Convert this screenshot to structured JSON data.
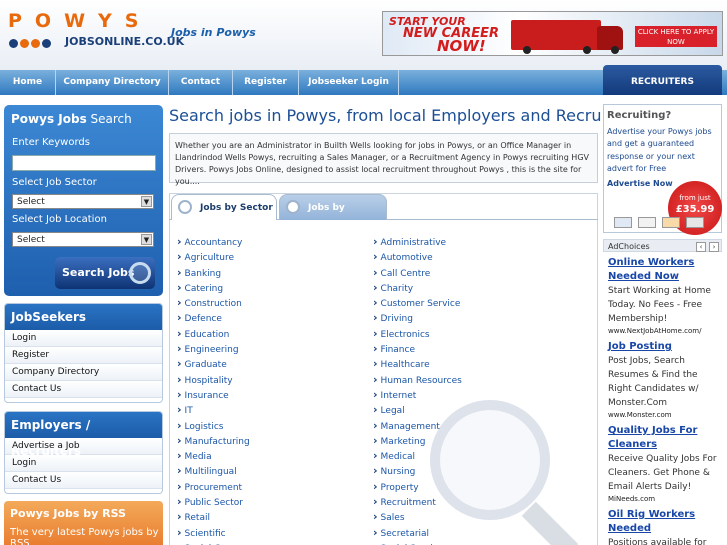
{
  "logo": {
    "letters": "POWYS",
    "subtitle": "JOBSONLINE.CO.UK",
    "dot_colors": [
      "#1b3f78",
      "#e86a0c",
      "#e86a0c",
      "#1b3f78"
    ]
  },
  "tagline": "Jobs in Powys",
  "banner": {
    "line1": "START YOUR",
    "line2": "NEW CAREER",
    "line3": "NOW!",
    "cta": "CLICK HERE TO APPLY NOW"
  },
  "nav": {
    "items": [
      "Home",
      "Company Directory",
      "Contact",
      "Register",
      "Jobseeker Login"
    ],
    "recruiters": "RECRUITERS"
  },
  "search": {
    "title_bold": "Powys Jobs",
    "title_rest": " Search",
    "keywords_label": "Enter Keywords",
    "keywords_value": "",
    "sector_label": "Select Job Sector",
    "sector_value": "Select",
    "location_label": "Select Job Location",
    "location_value": "Select",
    "button": "Search Jobs"
  },
  "jobseekers": {
    "title": "JobSeekers",
    "items": [
      "Login",
      "Register",
      "Company Directory",
      "Contact Us"
    ]
  },
  "employers": {
    "title": "Employers / Recruiters",
    "items": [
      "Advertise a Job",
      "Login",
      "Contact Us"
    ]
  },
  "rss": {
    "title": "Powys Jobs by RSS",
    "subtitle": "The very latest Powys jobs by RSS"
  },
  "main": {
    "title": "Search jobs in Powys, from local Employers and Recruiters",
    "intro": "Whether you are an Administrator in Builth Wells looking for jobs in Powys, or an Office Manager in Llandrindod Wells Powys, recruiting a Sales Manager, or a Recruitment Agency in Powys recruiting HGV Drivers. Powys Jobs Online, designed to assist local recruitment throughout Powys , this is the site for you....",
    "tabs": [
      "Jobs by Sector",
      "Jobs by Location"
    ],
    "sectors_left": [
      "Accountancy",
      "Agriculture",
      "Banking",
      "Catering",
      "Construction",
      "Defence",
      "Education",
      "Engineering",
      "Graduate",
      "Hospitality",
      "Insurance",
      "IT",
      "Logistics",
      "Manufacturing",
      "Media",
      "Multilingual",
      "Procurement",
      "Public Sector",
      "Retail",
      "Scientific",
      "Social Care"
    ],
    "sectors_right": [
      "Administrative",
      "Automotive",
      "Call Centre",
      "Charity",
      "Customer Service",
      "Driving",
      "Electronics",
      "Finance",
      "Healthcare",
      "Human Resources",
      "Internet",
      "Legal",
      "Management",
      "Marketing",
      "Medical",
      "Nursing",
      "Property",
      "Recruitment",
      "Sales",
      "Secretarial",
      "Social Services"
    ]
  },
  "promo": {
    "title": "Recruiting?",
    "body": "Advertise your Powys jobs and get a guaranteed response or your next advert for Free",
    "link": "Advertise Now",
    "price_from": "from just",
    "price": "£35.99"
  },
  "ads": {
    "label": "AdChoices",
    "items": [
      {
        "title": "Online Workers Needed Now",
        "body": "Start Working at Home Today. No Fees - Free Membership!",
        "url": "www.NextJobAtHome.com/"
      },
      {
        "title": "Job Posting",
        "body": "Post Jobs, Search Resumes & Find the Right Candidates w/ Monster.Com",
        "url": "www.Monster.com"
      },
      {
        "title": "Quality Jobs For Cleaners",
        "body": "Receive Quality Jobs For Cleaners. Get Phone & Email Alerts Daily!",
        "url": "MiNeeds.com"
      },
      {
        "title": "Oil Rig Workers Needed",
        "body": "Positions available for",
        "url": ""
      }
    ]
  }
}
